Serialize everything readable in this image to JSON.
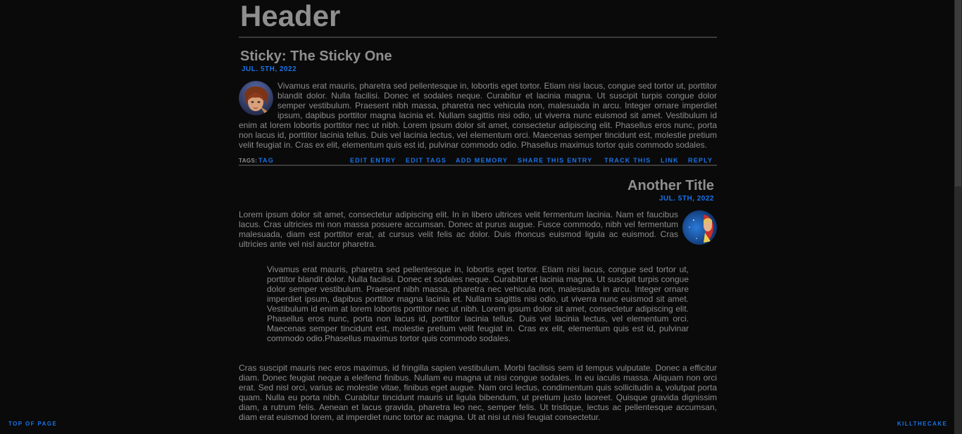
{
  "header": {
    "title": "Header"
  },
  "entries": [
    {
      "title": "Sticky: The Sticky One",
      "date": "JUL. 5TH, 2022",
      "body": "Vivamus erat mauris, pharetra sed pellentesque in, lobortis eget tortor. Etiam nisi lacus, congue sed tortor ut, porttitor blandit dolor. Nulla facilisi. Donec et sodales neque. Curabitur et lacinia magna. Ut suscipit turpis congue dolor semper vestibulum. Praesent nibh massa, pharetra nec vehicula non, malesuada in arcu. Integer ornare imperdiet ipsum, dapibus porttitor magna lacinia et. Nullam sagittis nisi odio, ut viverra nunc euismod sit amet. Vestibulum id enim at lorem lobortis porttitor nec ut nibh. Lorem ipsum dolor sit amet, consectetur adipiscing elit. Phasellus eros nunc, porta non lacus id, porttitor lacinia tellus. Duis vel lacinia lectus, vel elementum orci. Maecenas semper tincidunt est, molestie pretium velit feugiat in. Cras ex elit, elementum quis est id, pulvinar commodo odio. Phasellus maximus tortor quis commodo sodales.",
      "tags_label": "TAGS:",
      "tag": "TAG",
      "actions": {
        "edit_entry": "EDIT ENTRY",
        "edit_tags": "EDIT TAGS",
        "add_memory": "ADD MEMORY",
        "share": "SHARE THIS ENTRY",
        "track": "TRACK THIS",
        "link": "LINK",
        "reply": "REPLY"
      }
    },
    {
      "title": "Another Title",
      "date": "JUL. 5TH, 2022",
      "para1": "Lorem ipsum dolor sit amet, consectetur adipiscing elit. In in libero ultrices velit fermentum lacinia. Nam et faucibus lacus. Cras ultricies mi non massa posuere accumsan. Donec at purus augue. Fusce commodo, nibh vel fermentum malesuada, diam est porttitor erat, at cursus velit felis ac dolor. Duis rhoncus euismod ligula ac euismod. Cras ultricies ante vel nisl auctor pharetra.",
      "quote": "Vivamus erat mauris, pharetra sed pellentesque in, lobortis eget tortor. Etiam nisi lacus, congue sed tortor ut, porttitor blandit dolor. Nulla facilisi. Donec et sodales neque. Curabitur et lacinia magna. Ut suscipit turpis congue dolor semper vestibulum. Praesent nibh massa, pharetra nec vehicula non, malesuada in arcu. Integer ornare imperdiet ipsum, dapibus porttitor magna lacinia et. Nullam sagittis nisi odio, ut viverra nunc euismod sit amet. Vestibulum id enim at lorem lobortis porttitor nec ut nibh. Lorem ipsum dolor sit amet, consectetur adipiscing elit. Phasellus eros nunc, porta non lacus id, porttitor lacinia tellus. Duis vel lacinia lectus, vel elementum orci. Maecenas semper tincidunt est, molestie pretium velit feugiat in. Cras ex elit, elementum quis est id, pulvinar commodo odio.Phasellus maximus tortor quis commodo sodales.",
      "para2": "Cras suscipit mauris nec eros maximus, id fringilla sapien vestibulum. Morbi facilisis sem id tempus vulputate. Donec a efficitur diam. Donec feugiat neque a eleifend finibus. Nullam eu magna ut nisi congue sodales. In eu iaculis massa. Aliquam non orci erat. Sed nisl orci, varius ac molestie vitae, finibus eget augue. Nam orci lectus, condimentum quis sollicitudin a, volutpat porta quam. Nulla eu porta nibh. Curabitur tincidunt mauris ut ligula bibendum, ut pretium justo laoreet. Quisque gravida dignissim diam, a rutrum felis. Aenean et lacus gravida, pharetra leo nec, semper felis. Ut tristique, lectus ac pellentesque accumsan, diam erat euismod lorem, at imperdiet nunc tortor ac magna. Ut at nisi ut nisi feugiat consectetur."
    }
  ],
  "footer": {
    "top_of_page": "TOP OF PAGE",
    "credit": "KILLTHECAKE"
  },
  "colors": {
    "background": "#0a0a0a",
    "text": "#8c8c8c",
    "accent": "#1a73e8",
    "rule": "#3a3a3a"
  }
}
